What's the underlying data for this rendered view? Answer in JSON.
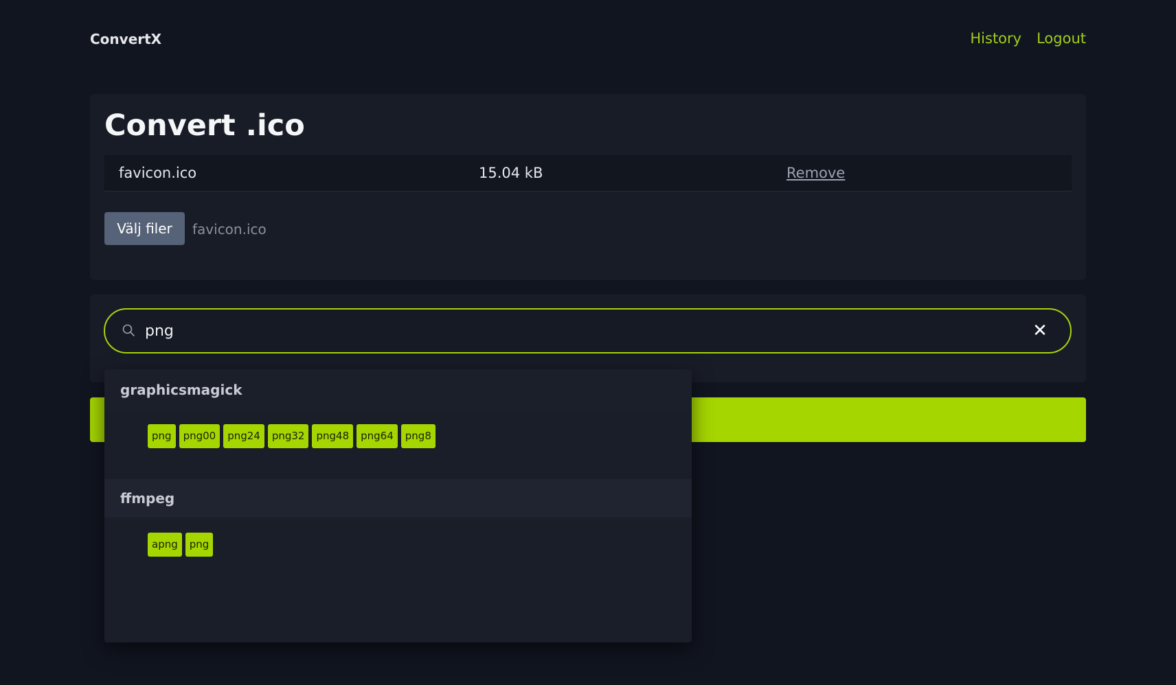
{
  "header": {
    "brand": "ConvertX",
    "nav": [
      "History",
      "Logout"
    ]
  },
  "upload": {
    "title": "Convert .ico",
    "file": {
      "name": "favicon.ico",
      "size": "15.04 kB",
      "remove_label": "Remove"
    },
    "choose_button": "Välj filer",
    "chosen_file": "favicon.ico"
  },
  "search": {
    "value": "png",
    "icon": "search-icon",
    "clear_icon": "close-icon"
  },
  "dropdown": {
    "groups": [
      {
        "name": "graphicsmagick",
        "options": [
          "png",
          "png00",
          "png24",
          "png32",
          "png48",
          "png64",
          "png8"
        ]
      },
      {
        "name": "ffmpeg",
        "options": [
          "apng",
          "png"
        ]
      }
    ]
  },
  "colors": {
    "accent": "#a6d600",
    "background": "#111520",
    "card": "#181c27",
    "button": "#566278"
  }
}
